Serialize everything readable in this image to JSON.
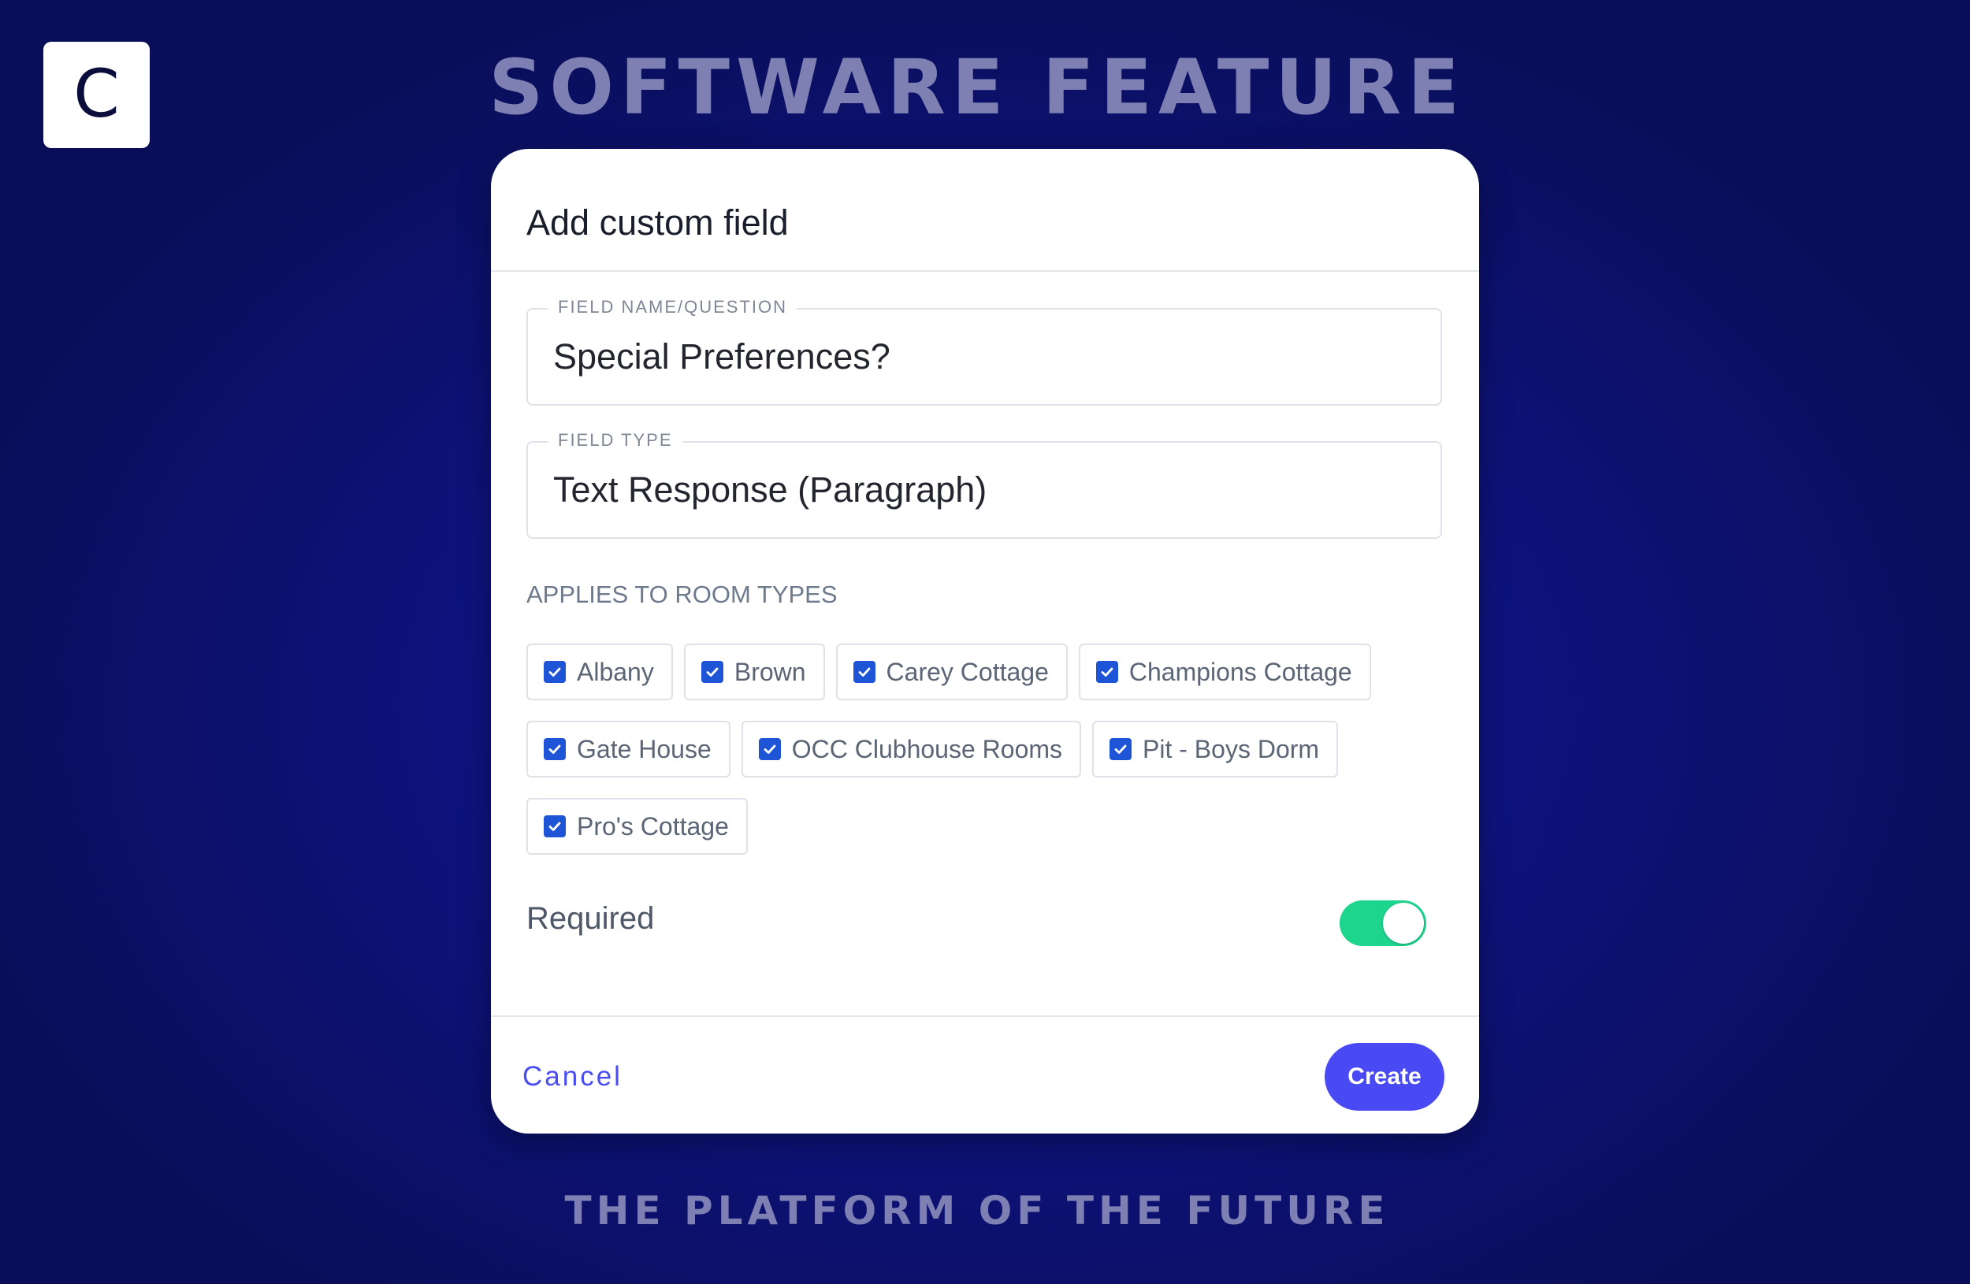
{
  "brand": {
    "logo_letter": "C",
    "headline": "SOFTWARE FEATURE",
    "tagline": "THE PLATFORM OF THE FUTURE"
  },
  "dialog": {
    "title": "Add custom field",
    "field_name": {
      "label": "FIELD NAME/QUESTION",
      "value": "Special Preferences?"
    },
    "field_type": {
      "label": "FIELD TYPE",
      "value": "Text Response (Paragraph)"
    },
    "room_types": {
      "label": "APPLIES TO ROOM TYPES",
      "items": [
        {
          "label": "Albany",
          "checked": true
        },
        {
          "label": "Brown",
          "checked": true
        },
        {
          "label": "Carey Cottage",
          "checked": true
        },
        {
          "label": "Champions Cottage",
          "checked": true
        },
        {
          "label": "Gate House",
          "checked": true
        },
        {
          "label": "OCC Clubhouse Rooms",
          "checked": true
        },
        {
          "label": "Pit - Boys Dorm",
          "checked": true
        },
        {
          "label": "Pro's Cottage",
          "checked": true
        }
      ]
    },
    "required": {
      "label": "Required",
      "on": true
    },
    "cancel_label": "Cancel",
    "create_label": "Create"
  },
  "colors": {
    "accent": "#4a4af4",
    "checkbox": "#1d55d6",
    "toggle_on": "#1ed58d",
    "background": "#0e1380"
  }
}
